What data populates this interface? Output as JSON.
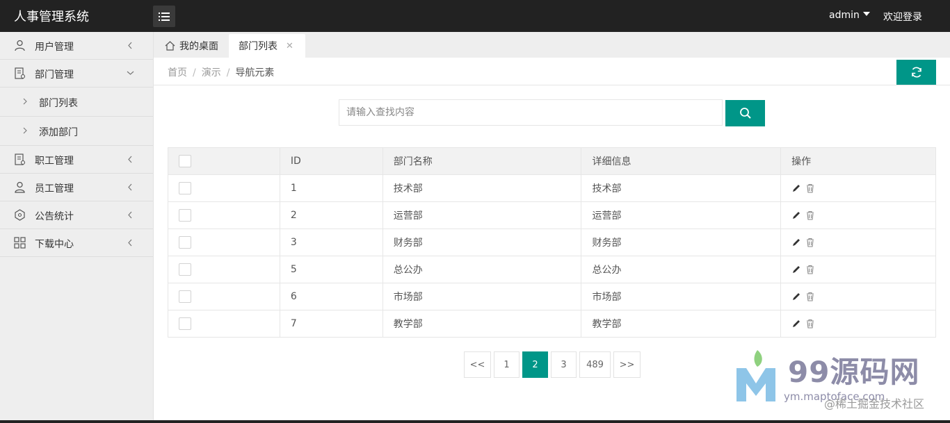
{
  "header": {
    "app_title": "人事管理系统",
    "user": "admin",
    "welcome": "欢迎登录"
  },
  "sidebar": {
    "items": [
      {
        "label": "用户管理",
        "icon": "user-icon",
        "expanded": false
      },
      {
        "label": "部门管理",
        "icon": "department-icon",
        "expanded": true,
        "children": [
          {
            "label": "部门列表"
          },
          {
            "label": "添加部门"
          }
        ]
      },
      {
        "label": "职工管理",
        "icon": "staff-icon",
        "expanded": false
      },
      {
        "label": "员工管理",
        "icon": "employee-icon",
        "expanded": false
      },
      {
        "label": "公告统计",
        "icon": "notice-icon",
        "expanded": false
      },
      {
        "label": "下载中心",
        "icon": "grid-icon",
        "expanded": false
      }
    ]
  },
  "tabs": [
    {
      "label": "我的桌面",
      "icon": "home-icon"
    },
    {
      "label": "部门列表",
      "active": true
    }
  ],
  "breadcrumb": [
    "首页",
    "演示",
    "导航元素"
  ],
  "search": {
    "placeholder": "请输入查找内容",
    "value": ""
  },
  "table": {
    "columns": [
      "",
      "ID",
      "部门名称",
      "详细信息",
      "操作"
    ],
    "rows": [
      {
        "id": "1",
        "name": "技术部",
        "detail": "技术部"
      },
      {
        "id": "2",
        "name": "运营部",
        "detail": "运营部"
      },
      {
        "id": "3",
        "name": "财务部",
        "detail": "财务部"
      },
      {
        "id": "5",
        "name": "总公办",
        "detail": "总公办"
      },
      {
        "id": "6",
        "name": "市场部",
        "detail": "市场部"
      },
      {
        "id": "7",
        "name": "教学部",
        "detail": "教学部"
      }
    ]
  },
  "pagination": {
    "items": [
      "<<",
      "1",
      "2",
      "3",
      "489",
      ">>"
    ],
    "current": "2"
  },
  "watermark": {
    "logo": "99源码网",
    "url": "ym.maptoface.com",
    "community": "@稀土掘金技术社区"
  },
  "colors": {
    "accent": "#009688",
    "topbar": "#222222",
    "sidebar": "#eeeeee"
  }
}
